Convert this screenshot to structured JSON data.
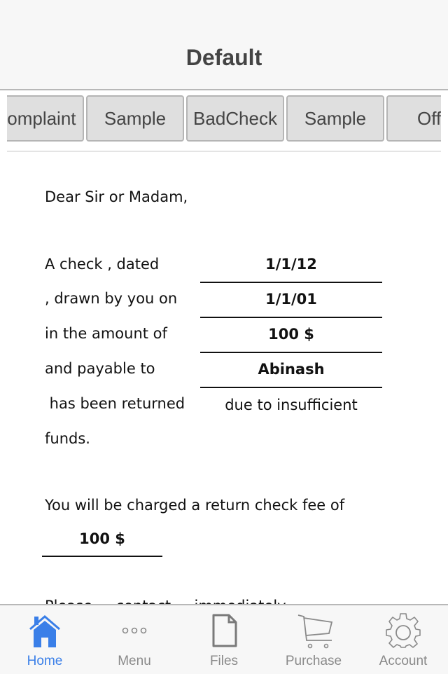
{
  "header": {
    "title": "Default"
  },
  "segments": [
    {
      "label": "Complaint"
    },
    {
      "label": "Sample"
    },
    {
      "label": "BadCheck"
    },
    {
      "label": "Sample"
    },
    {
      "label": "Offer"
    }
  ],
  "letter": {
    "greeting": "Dear Sir or Madam,",
    "rows": [
      {
        "label": "A check , dated",
        "value": "1/1/12"
      },
      {
        "label": ", drawn by you on",
        "value": "1/1/01"
      },
      {
        "label": "in the amount of",
        "value": "100 $"
      },
      {
        "label": "and payable to",
        "value": "Abinash"
      }
    ],
    "returned_label": " has been returned",
    "returned_reason": "due to insufficient",
    "funds": "funds.",
    "fee_text": "You will be charged a return check fee of",
    "fee_value": "100 $",
    "cutoff_line": "Please ... contact ... immediately ..."
  },
  "tabbar": {
    "items": [
      {
        "label": "Home",
        "icon": "home-icon",
        "active": true
      },
      {
        "label": "Menu",
        "icon": "more-icon",
        "active": false
      },
      {
        "label": "Files",
        "icon": "file-icon",
        "active": false
      },
      {
        "label": "Purchase",
        "icon": "cart-icon",
        "active": false
      },
      {
        "label": "Account",
        "icon": "gear-icon",
        "active": false
      }
    ],
    "active_color": "#3a7fe8",
    "inactive_color": "#8a8a8a"
  }
}
